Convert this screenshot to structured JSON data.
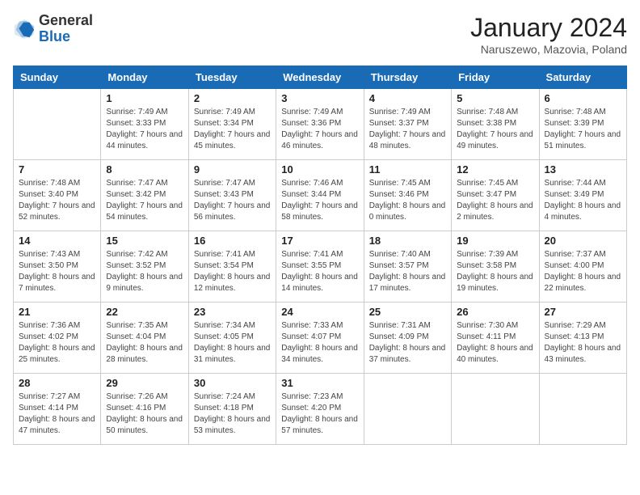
{
  "header": {
    "logo_general": "General",
    "logo_blue": "Blue",
    "month_title": "January 2024",
    "location": "Naruszewo, Mazovia, Poland"
  },
  "days_of_week": [
    "Sunday",
    "Monday",
    "Tuesday",
    "Wednesday",
    "Thursday",
    "Friday",
    "Saturday"
  ],
  "weeks": [
    [
      {
        "day": "",
        "sunrise": "",
        "sunset": "",
        "daylight": ""
      },
      {
        "day": "1",
        "sunrise": "Sunrise: 7:49 AM",
        "sunset": "Sunset: 3:33 PM",
        "daylight": "Daylight: 7 hours and 44 minutes."
      },
      {
        "day": "2",
        "sunrise": "Sunrise: 7:49 AM",
        "sunset": "Sunset: 3:34 PM",
        "daylight": "Daylight: 7 hours and 45 minutes."
      },
      {
        "day": "3",
        "sunrise": "Sunrise: 7:49 AM",
        "sunset": "Sunset: 3:36 PM",
        "daylight": "Daylight: 7 hours and 46 minutes."
      },
      {
        "day": "4",
        "sunrise": "Sunrise: 7:49 AM",
        "sunset": "Sunset: 3:37 PM",
        "daylight": "Daylight: 7 hours and 48 minutes."
      },
      {
        "day": "5",
        "sunrise": "Sunrise: 7:48 AM",
        "sunset": "Sunset: 3:38 PM",
        "daylight": "Daylight: 7 hours and 49 minutes."
      },
      {
        "day": "6",
        "sunrise": "Sunrise: 7:48 AM",
        "sunset": "Sunset: 3:39 PM",
        "daylight": "Daylight: 7 hours and 51 minutes."
      }
    ],
    [
      {
        "day": "7",
        "sunrise": "Sunrise: 7:48 AM",
        "sunset": "Sunset: 3:40 PM",
        "daylight": "Daylight: 7 hours and 52 minutes."
      },
      {
        "day": "8",
        "sunrise": "Sunrise: 7:47 AM",
        "sunset": "Sunset: 3:42 PM",
        "daylight": "Daylight: 7 hours and 54 minutes."
      },
      {
        "day": "9",
        "sunrise": "Sunrise: 7:47 AM",
        "sunset": "Sunset: 3:43 PM",
        "daylight": "Daylight: 7 hours and 56 minutes."
      },
      {
        "day": "10",
        "sunrise": "Sunrise: 7:46 AM",
        "sunset": "Sunset: 3:44 PM",
        "daylight": "Daylight: 7 hours and 58 minutes."
      },
      {
        "day": "11",
        "sunrise": "Sunrise: 7:45 AM",
        "sunset": "Sunset: 3:46 PM",
        "daylight": "Daylight: 8 hours and 0 minutes."
      },
      {
        "day": "12",
        "sunrise": "Sunrise: 7:45 AM",
        "sunset": "Sunset: 3:47 PM",
        "daylight": "Daylight: 8 hours and 2 minutes."
      },
      {
        "day": "13",
        "sunrise": "Sunrise: 7:44 AM",
        "sunset": "Sunset: 3:49 PM",
        "daylight": "Daylight: 8 hours and 4 minutes."
      }
    ],
    [
      {
        "day": "14",
        "sunrise": "Sunrise: 7:43 AM",
        "sunset": "Sunset: 3:50 PM",
        "daylight": "Daylight: 8 hours and 7 minutes."
      },
      {
        "day": "15",
        "sunrise": "Sunrise: 7:42 AM",
        "sunset": "Sunset: 3:52 PM",
        "daylight": "Daylight: 8 hours and 9 minutes."
      },
      {
        "day": "16",
        "sunrise": "Sunrise: 7:41 AM",
        "sunset": "Sunset: 3:54 PM",
        "daylight": "Daylight: 8 hours and 12 minutes."
      },
      {
        "day": "17",
        "sunrise": "Sunrise: 7:41 AM",
        "sunset": "Sunset: 3:55 PM",
        "daylight": "Daylight: 8 hours and 14 minutes."
      },
      {
        "day": "18",
        "sunrise": "Sunrise: 7:40 AM",
        "sunset": "Sunset: 3:57 PM",
        "daylight": "Daylight: 8 hours and 17 minutes."
      },
      {
        "day": "19",
        "sunrise": "Sunrise: 7:39 AM",
        "sunset": "Sunset: 3:58 PM",
        "daylight": "Daylight: 8 hours and 19 minutes."
      },
      {
        "day": "20",
        "sunrise": "Sunrise: 7:37 AM",
        "sunset": "Sunset: 4:00 PM",
        "daylight": "Daylight: 8 hours and 22 minutes."
      }
    ],
    [
      {
        "day": "21",
        "sunrise": "Sunrise: 7:36 AM",
        "sunset": "Sunset: 4:02 PM",
        "daylight": "Daylight: 8 hours and 25 minutes."
      },
      {
        "day": "22",
        "sunrise": "Sunrise: 7:35 AM",
        "sunset": "Sunset: 4:04 PM",
        "daylight": "Daylight: 8 hours and 28 minutes."
      },
      {
        "day": "23",
        "sunrise": "Sunrise: 7:34 AM",
        "sunset": "Sunset: 4:05 PM",
        "daylight": "Daylight: 8 hours and 31 minutes."
      },
      {
        "day": "24",
        "sunrise": "Sunrise: 7:33 AM",
        "sunset": "Sunset: 4:07 PM",
        "daylight": "Daylight: 8 hours and 34 minutes."
      },
      {
        "day": "25",
        "sunrise": "Sunrise: 7:31 AM",
        "sunset": "Sunset: 4:09 PM",
        "daylight": "Daylight: 8 hours and 37 minutes."
      },
      {
        "day": "26",
        "sunrise": "Sunrise: 7:30 AM",
        "sunset": "Sunset: 4:11 PM",
        "daylight": "Daylight: 8 hours and 40 minutes."
      },
      {
        "day": "27",
        "sunrise": "Sunrise: 7:29 AM",
        "sunset": "Sunset: 4:13 PM",
        "daylight": "Daylight: 8 hours and 43 minutes."
      }
    ],
    [
      {
        "day": "28",
        "sunrise": "Sunrise: 7:27 AM",
        "sunset": "Sunset: 4:14 PM",
        "daylight": "Daylight: 8 hours and 47 minutes."
      },
      {
        "day": "29",
        "sunrise": "Sunrise: 7:26 AM",
        "sunset": "Sunset: 4:16 PM",
        "daylight": "Daylight: 8 hours and 50 minutes."
      },
      {
        "day": "30",
        "sunrise": "Sunrise: 7:24 AM",
        "sunset": "Sunset: 4:18 PM",
        "daylight": "Daylight: 8 hours and 53 minutes."
      },
      {
        "day": "31",
        "sunrise": "Sunrise: 7:23 AM",
        "sunset": "Sunset: 4:20 PM",
        "daylight": "Daylight: 8 hours and 57 minutes."
      },
      {
        "day": "",
        "sunrise": "",
        "sunset": "",
        "daylight": ""
      },
      {
        "day": "",
        "sunrise": "",
        "sunset": "",
        "daylight": ""
      },
      {
        "day": "",
        "sunrise": "",
        "sunset": "",
        "daylight": ""
      }
    ]
  ]
}
